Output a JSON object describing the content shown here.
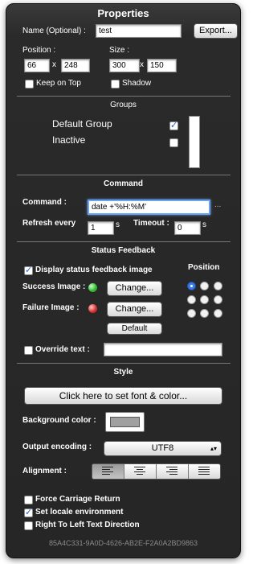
{
  "window": {
    "title": "Properties"
  },
  "top": {
    "name_label": "Name (Optional) :",
    "name_value": "test",
    "export_label": "Export...",
    "position_label": "Position :",
    "pos_x": "66",
    "pos_y": "248",
    "x_sep": "x",
    "size_label": "Size :",
    "size_w": "300",
    "size_h": "150",
    "keep_on_top": "Keep on Top",
    "shadow": "Shadow"
  },
  "groups": {
    "header": "Groups",
    "items": [
      {
        "label": "Default Group",
        "checked": true
      },
      {
        "label": "Inactive",
        "checked": false
      }
    ]
  },
  "command": {
    "header": "Command",
    "label": "Command :",
    "value": "date +'%H:%M'",
    "more": "...",
    "refresh_label": "Refresh every",
    "refresh_value": "1",
    "refresh_unit": "s",
    "timeout_label": "Timeout :",
    "timeout_value": "0",
    "timeout_unit": "s"
  },
  "status": {
    "header": "Status Feedback",
    "display_label": "Display status feedback image",
    "display_checked": true,
    "position_label": "Position",
    "success_label": "Success Image :",
    "failure_label": "Failure Image :",
    "change_label": "Change...",
    "default_label": "Default",
    "override_label": "Override text :",
    "override_value": "",
    "success_color": "#2bb52b",
    "failure_color": "#d62a2a"
  },
  "style": {
    "header": "Style",
    "font_button": "Click here to set font & color...",
    "bg_label": "Background color :",
    "bg_color": "#a0a0a0",
    "encoding_label": "Output encoding :",
    "encoding_value": "UTF8",
    "alignment_label": "Alignment :",
    "alignment_options": [
      "left",
      "center",
      "right",
      "justify"
    ],
    "alignment_selected": "left",
    "force_cr": "Force Carriage Return",
    "locale": "Set locale environment",
    "locale_checked": true,
    "rtl": "Right To Left Text Direction"
  },
  "footer": {
    "uuid": "85A4C331-9A0D-4626-AB2E-F2A0A2BD9863"
  }
}
